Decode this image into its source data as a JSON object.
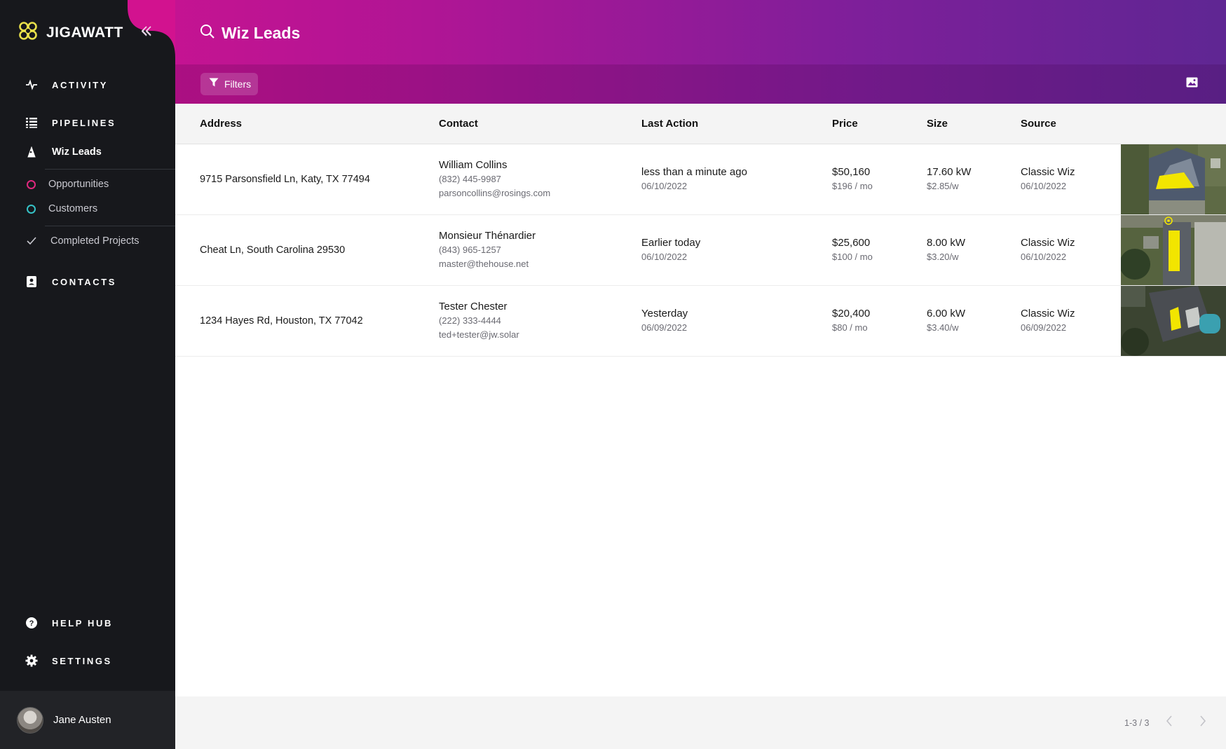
{
  "app": {
    "brand": "JIGAWATT",
    "title": "Wiz Leads",
    "colors": {
      "accent_pink": "#d2128f",
      "accent_purple": "#5f2693",
      "sidebar": "#17181c",
      "highlight_yellow": "#f2e500"
    }
  },
  "sidebar": {
    "collapse_icon": "double-chevron-left-icon",
    "activity": {
      "label": "ACTIVITY",
      "icon": "pulse-icon"
    },
    "pipelines": {
      "label": "PIPELINES",
      "icon": "list-icon"
    },
    "wiz_leads": {
      "label": "Wiz Leads",
      "icon": "wizard-hat-icon"
    },
    "opportunities": {
      "label": "Opportunities",
      "icon": "ring-icon",
      "color": "#e0287e"
    },
    "customers": {
      "label": "Customers",
      "icon": "ring-icon",
      "color": "#35c2c6"
    },
    "completed": {
      "label": "Completed Projects",
      "icon": "check-icon"
    },
    "contacts": {
      "label": "CONTACTS",
      "icon": "contact-card-icon"
    },
    "help": {
      "label": "HELP HUB",
      "icon": "help-icon"
    },
    "settings": {
      "label": "SETTINGS",
      "icon": "gear-icon"
    },
    "user": {
      "name": "Jane Austen"
    }
  },
  "toolbar": {
    "filters_label": "Filters",
    "image_toggle_icon": "image-icon"
  },
  "table": {
    "columns": {
      "address": "Address",
      "contact": "Contact",
      "last_action": "Last Action",
      "price": "Price",
      "size": "Size",
      "source": "Source"
    },
    "rows": [
      {
        "address": "9715 Parsonsfield Ln, Katy, TX 77494",
        "contact_name": "William Collins",
        "contact_phone": "(832) 445-9987",
        "contact_email": "parsoncollins@rosings.com",
        "last_action": "less than a minute ago",
        "last_action_date": "06/10/2022",
        "price": "$50,160",
        "price_monthly": "$196 / mo",
        "size": "17.60 kW",
        "size_rate": "$2.85/w",
        "source": "Classic Wiz",
        "source_date": "06/10/2022"
      },
      {
        "address": "Cheat Ln, South Carolina 29530",
        "contact_name": "Monsieur Thénardier",
        "contact_phone": "(843) 965-1257",
        "contact_email": "master@thehouse.net",
        "last_action": "Earlier today",
        "last_action_date": "06/10/2022",
        "price": "$25,600",
        "price_monthly": "$100 / mo",
        "size": "8.00 kW",
        "size_rate": "$3.20/w",
        "source": "Classic Wiz",
        "source_date": "06/10/2022"
      },
      {
        "address": "1234 Hayes Rd, Houston, TX 77042",
        "contact_name": "Tester Chester",
        "contact_phone": "(222) 333-4444",
        "contact_email": "ted+tester@jw.solar",
        "last_action": "Yesterday",
        "last_action_date": "06/09/2022",
        "price": "$20,400",
        "price_monthly": "$80 / mo",
        "size": "6.00 kW",
        "size_rate": "$3.40/w",
        "source": "Classic Wiz",
        "source_date": "06/09/2022"
      }
    ]
  },
  "pagination": {
    "range": "1-3 / 3",
    "prev_icon": "chevron-left-icon",
    "next_icon": "chevron-right-icon"
  }
}
